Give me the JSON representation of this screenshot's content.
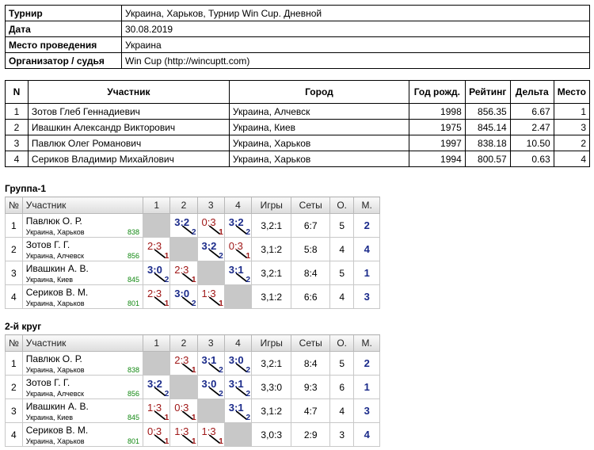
{
  "info": [
    {
      "label": "Турнир",
      "value": "Украина, Харьков, Турнир Win Cup. Дневной"
    },
    {
      "label": "Дата",
      "value": "30.08.2019"
    },
    {
      "label": "Место проведения",
      "value": "Украина"
    },
    {
      "label": "Организатор / судья",
      "value": "Win Cup (http://wincuptt.com)"
    }
  ],
  "participants": {
    "headers": [
      "N",
      "Участник",
      "Город",
      "Год рожд.",
      "Рейтинг",
      "Дельта",
      "Место"
    ],
    "rows": [
      [
        "1",
        "Зотов Глеб Геннадиевич",
        "Украина, Алчевск",
        "1998",
        "856.35",
        "6.67",
        "1"
      ],
      [
        "2",
        "Ивашкин Александр Викторович",
        "Украина, Киев",
        "1975",
        "845.14",
        "2.47",
        "3"
      ],
      [
        "3",
        "Павлюк Олег Романович",
        "Украина, Харьков",
        "1997",
        "838.18",
        "10.50",
        "2"
      ],
      [
        "4",
        "Сериков Владимир Михайлович",
        "Украина, Харьков",
        "1994",
        "800.57",
        "0.63",
        "4"
      ]
    ]
  },
  "groups": [
    {
      "title": "Группа-1",
      "headers": [
        "№",
        "Участник",
        "1",
        "2",
        "3",
        "4",
        "Игры",
        "Сеты",
        "О.",
        "М."
      ],
      "rows": [
        {
          "n": "1",
          "name": "Павлюк О. Р.",
          "city": "Украина, Харьков",
          "rating": "838",
          "cells": [
            null,
            {
              "s": "3:2",
              "p": "2"
            },
            {
              "s": "0:3",
              "p": "1"
            },
            {
              "s": "3:2",
              "p": "2"
            }
          ],
          "games": "3,2:1",
          "sets": "6:7",
          "points": "5",
          "place": "2"
        },
        {
          "n": "2",
          "name": "Зотов Г. Г.",
          "city": "Украина, Алчевск",
          "rating": "856",
          "cells": [
            {
              "s": "2:3",
              "p": "1"
            },
            null,
            {
              "s": "3:2",
              "p": "2"
            },
            {
              "s": "0:3",
              "p": "1"
            }
          ],
          "games": "3,1:2",
          "sets": "5:8",
          "points": "4",
          "place": "4"
        },
        {
          "n": "3",
          "name": "Ивашкин А. В.",
          "city": "Украина, Киев",
          "rating": "845",
          "cells": [
            {
              "s": "3:0",
              "p": "2"
            },
            {
              "s": "2:3",
              "p": "1"
            },
            null,
            {
              "s": "3:1",
              "p": "2"
            }
          ],
          "games": "3,2:1",
          "sets": "8:4",
          "points": "5",
          "place": "1"
        },
        {
          "n": "4",
          "name": "Сериков В. М.",
          "city": "Украина, Харьков",
          "rating": "801",
          "cells": [
            {
              "s": "2:3",
              "p": "1"
            },
            {
              "s": "3:0",
              "p": "2"
            },
            {
              "s": "1:3",
              "p": "1"
            },
            null
          ],
          "games": "3,1:2",
          "sets": "6:6",
          "points": "4",
          "place": "3"
        }
      ]
    },
    {
      "title": "2-й круг",
      "headers": [
        "№",
        "Участник",
        "1",
        "2",
        "3",
        "4",
        "Игры",
        "Сеты",
        "О.",
        "М."
      ],
      "rows": [
        {
          "n": "1",
          "name": "Павлюк О. Р.",
          "city": "Украина, Харьков",
          "rating": "838",
          "cells": [
            null,
            {
              "s": "2:3",
              "p": "1"
            },
            {
              "s": "3:1",
              "p": "2"
            },
            {
              "s": "3:0",
              "p": "2"
            }
          ],
          "games": "3,2:1",
          "sets": "8:4",
          "points": "5",
          "place": "2"
        },
        {
          "n": "2",
          "name": "Зотов Г. Г.",
          "city": "Украина, Алчевск",
          "rating": "856",
          "cells": [
            {
              "s": "3:2",
              "p": "2"
            },
            null,
            {
              "s": "3:0",
              "p": "2"
            },
            {
              "s": "3:1",
              "p": "2"
            }
          ],
          "games": "3,3:0",
          "sets": "9:3",
          "points": "6",
          "place": "1"
        },
        {
          "n": "3",
          "name": "Ивашкин А. В.",
          "city": "Украина, Киев",
          "rating": "845",
          "cells": [
            {
              "s": "1:3",
              "p": "1"
            },
            {
              "s": "0:3",
              "p": "1"
            },
            null,
            {
              "s": "3:1",
              "p": "2"
            }
          ],
          "games": "3,1:2",
          "sets": "4:7",
          "points": "4",
          "place": "3"
        },
        {
          "n": "4",
          "name": "Сериков В. М.",
          "city": "Украина, Харьков",
          "rating": "801",
          "cells": [
            {
              "s": "0:3",
              "p": "1"
            },
            {
              "s": "1:3",
              "p": "1"
            },
            {
              "s": "1:3",
              "p": "1"
            },
            null
          ],
          "games": "3,0:3",
          "sets": "2:9",
          "points": "3",
          "place": "4"
        }
      ]
    }
  ],
  "colors": {
    "win": "#1a2a8a",
    "loss": "#a01818",
    "rating": "#118811",
    "self_cell": "#c8c8c8"
  }
}
